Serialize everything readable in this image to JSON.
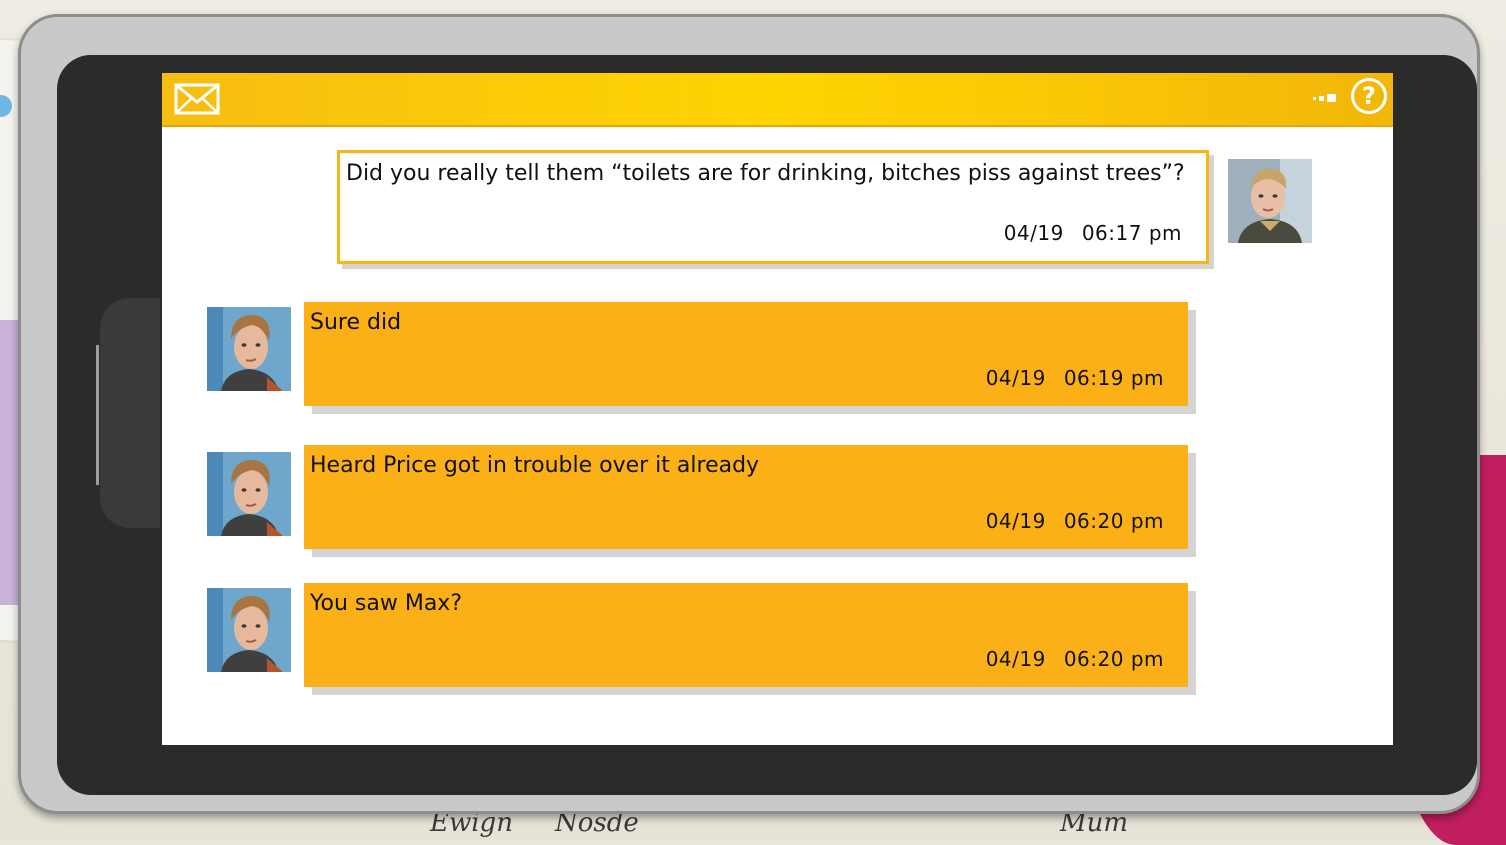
{
  "app": {
    "topbar_icons": [
      "mail-icon",
      "signal-icon",
      "help-icon"
    ],
    "help_label": "?",
    "accent_color": "#fbb017"
  },
  "background": {
    "scribble_1": "Ewign",
    "scribble_2": "Nosde",
    "scribble_3": "Mum"
  },
  "messages": [
    {
      "direction": "outgoing",
      "text": "Did you really tell them “toilets are for drinking, bitches piss against trees”?",
      "date": "04/19",
      "time": "06:17 pm"
    },
    {
      "direction": "incoming",
      "text": "Sure did",
      "date": "04/19",
      "time": "06:19 pm"
    },
    {
      "direction": "incoming",
      "text": "Heard Price got in trouble over it already",
      "date": "04/19",
      "time": "06:20 pm"
    },
    {
      "direction": "incoming",
      "text": "You saw Max?",
      "date": "04/19",
      "time": "06:20 pm"
    }
  ]
}
